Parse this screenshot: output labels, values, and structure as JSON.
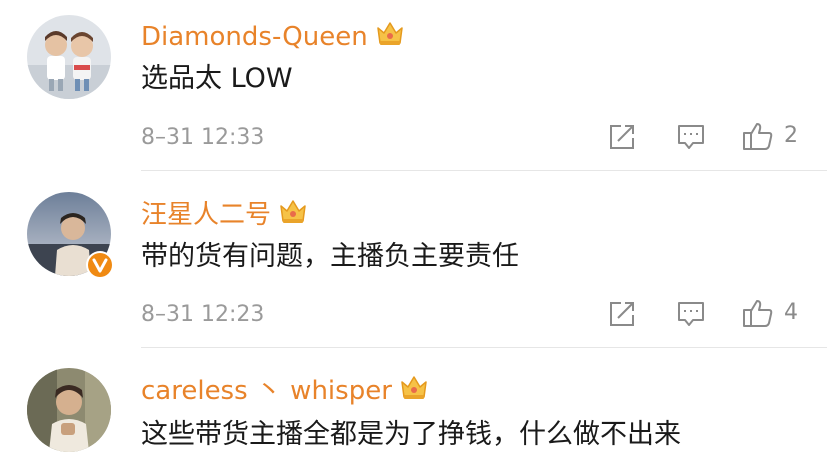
{
  "comments": [
    {
      "username": "Diamonds-Queen",
      "text": "选品太 LOW",
      "time": "8–31 12:33",
      "likes": "2",
      "verified": false,
      "avatar_icon": "two-children-avatar"
    },
    {
      "username": "汪星人二号",
      "text": "带的货有问题，主播负主要责任",
      "time": "8–31 12:23",
      "likes": "4",
      "verified": true,
      "avatar_icon": "person-avatar"
    },
    {
      "username": "careless 丶 whisper",
      "text": "这些带货主播全都是为了挣钱，什么做不出来",
      "verified": false,
      "avatar_icon": "man-avatar"
    }
  ],
  "colors": {
    "username": "#e8832a",
    "text": "#1a1a1a",
    "meta": "#9a9a9a",
    "icon": "#8a8a8a",
    "verified_badge": "#f08a12"
  },
  "icons": {
    "share": "share-icon",
    "reply": "comment-icon",
    "like": "thumbs-up-icon",
    "member": "crown-badge-icon"
  }
}
